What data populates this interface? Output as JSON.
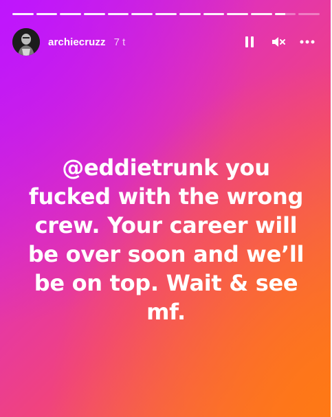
{
  "story": {
    "progress": {
      "segments_total": 13,
      "segments_viewed": 11,
      "current_segment_fraction": 0.5
    },
    "header": {
      "username": "archiecruzz",
      "time_ago": "7 t"
    },
    "controls": {
      "icons": [
        "pause-icon",
        "mute-icon",
        "more-icon"
      ]
    },
    "message": "@eddietrunk you\nfucked with the wrong\ncrew. Your career will\nbe over soon and we’ll\nbe on top. Wait & see\nmf.",
    "colors": {
      "gradient_top_left": "#c51ff0",
      "gradient_mid": "#f0437e",
      "gradient_bottom_right": "#fb7a1e",
      "text": "#ffffff"
    }
  }
}
